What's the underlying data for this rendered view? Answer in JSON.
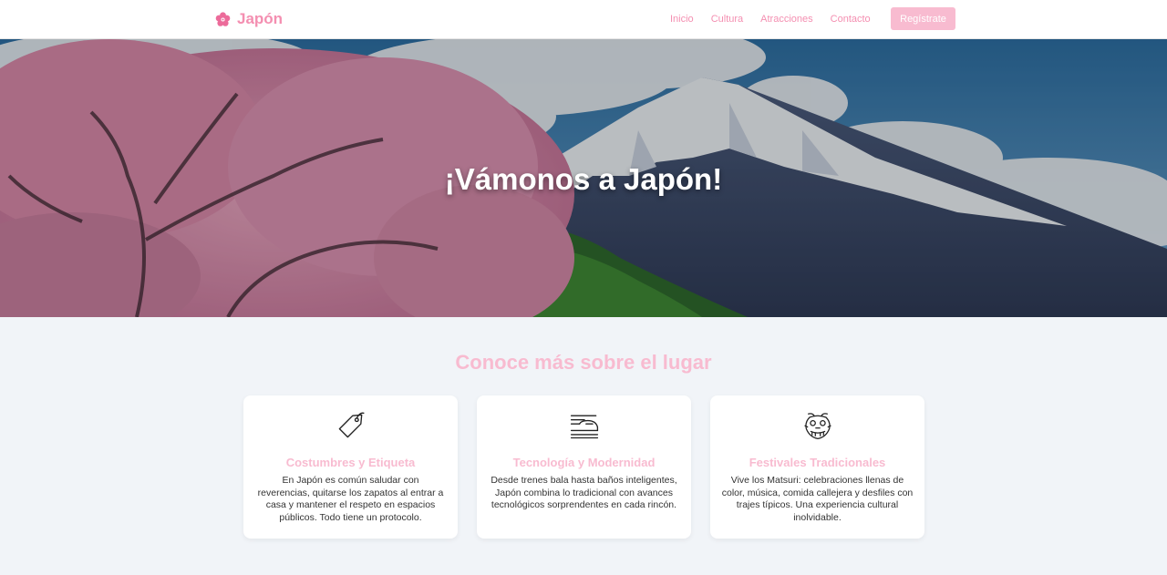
{
  "navbar": {
    "brand": {
      "name": "Japón",
      "icon": "sakura-flower-icon"
    },
    "links": [
      {
        "label": "Inicio"
      },
      {
        "label": "Cultura"
      },
      {
        "label": "Atracciones"
      },
      {
        "label": "Contacto"
      }
    ],
    "register_label": "Regístrate"
  },
  "hero": {
    "title": "¡Vámonos a Japón!",
    "image": "mount-fuji-cherry-blossom-photo"
  },
  "section": {
    "title": "Conoce más sobre el lugar",
    "cards": [
      {
        "icon": "tag-icon",
        "title": "Costumbres y Etiqueta",
        "text": "En Japón es común saludar con reverencias, quitarse los zapatos al entrar a casa y mantener el respeto en espacios públicos. Todo tiene un protocolo."
      },
      {
        "icon": "bullet-train-icon",
        "title": "Tecnología y Modernidad",
        "text": "Desde trenes bala hasta baños inteligentes, Japón combina lo tradicional con avances tecnológicos sorprendentes en cada rincón."
      },
      {
        "icon": "dragon-mask-icon",
        "title": "Festivales Tradicionales",
        "text": "Vive los Matsuri: celebraciones llenas de color, música, comida callejera y desfiles con trajes típicos. Una experiencia cultural inolvidable."
      }
    ]
  },
  "colors": {
    "accent": "#f48fb1",
    "accent_light": "#f8bbd0",
    "page_bg": "#f1f4f8"
  }
}
